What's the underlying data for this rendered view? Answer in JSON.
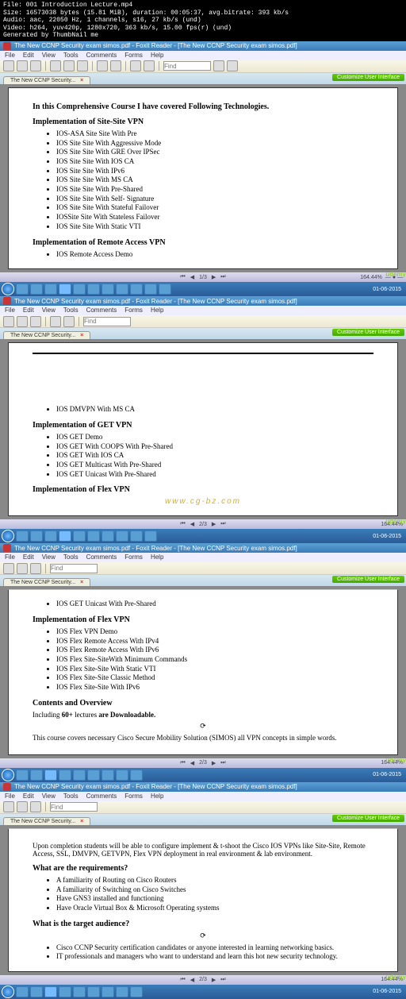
{
  "video_meta": [
    "File: 001 Introduction Lecture.mp4",
    "Size: 16573038 bytes (15.81 MiB), duration: 00:05:37, avg.bitrate: 393 kb/s",
    "Audio: aac, 22050 Hz, 1 channels, s16, 27 kb/s (und)",
    "Video: h264, yuv420p, 1280x720, 363 kb/s, 15.00 fps(r) (und)",
    "Generated by ThumbNail me"
  ],
  "window": {
    "title_full": "The New CCNP Security exam simos.pdf - Foxit Reader - [The New CCNP Security exam simos.pdf]",
    "title_short": "The New CCNP Security exam simos.pdf - Foxit Reader - [The New CCNP Security exam simos.pdf]",
    "tab_label": "The New CCNP Security...",
    "cui_label": "Customize User Interface"
  },
  "menu": [
    "File",
    "Edit",
    "View",
    "Tools",
    "Comments",
    "Forms",
    "Help"
  ],
  "toolbar": {
    "search_placeholder": "Find"
  },
  "status": {
    "page1": "1/3",
    "page2": "2/3",
    "page3": "2/3",
    "page4": "2/3",
    "zoom": "164.44%",
    "logo": "udemy",
    "time": "01-06-2015"
  },
  "seg1": {
    "h1": "In this Comprehensive Course I have covered Following Technologies.",
    "h2": "Implementation of Site-Site VPN",
    "items": [
      "IOS-ASA Site Site With Pre",
      "IOS Site Site With Aggressive Mode",
      "IOS Site Site With GRE Over IPSec",
      "IOS Site Site With IOS CA",
      "IOS Site Site With IPv6",
      "IOS Site Site With MS CA",
      "IOS Site Site With Pre-Shared",
      "IOS Site Site With Self- Signature",
      "IOS Site Site With Stateful Failover",
      "IOSSite Site With Stateless Failover",
      "IOS Site Site With Static VTI"
    ],
    "h3": "Implementation of Remote Access VPN",
    "items2": [
      "IOS Remote Access Demo"
    ]
  },
  "seg2": {
    "i1": [
      "IOS DMVPN With MS CA"
    ],
    "h1": "Implementation of GET VPN",
    "items": [
      "IOS GET Demo",
      "IOS GET With COOPS With Pre-Shared",
      "IOS GET With IOS CA",
      "IOS GET Multicast With Pre-Shared",
      "IOS GET Unicast With Pre-Shared"
    ],
    "h2": "Implementation of Flex VPN",
    "watermark": "www.cg-bz.com"
  },
  "seg3": {
    "i0": [
      "IOS GET Unicast With Pre-Shared"
    ],
    "h1": "Implementation of Flex VPN",
    "items": [
      "IOS Flex VPN Demo",
      "IOS Flex Remote Access With IPv4",
      "IOS Flex Remote Access With IPv6",
      "IOS Flex Site-SiteWith Minimum Commands",
      "IOS Flex Site-Site With Static VTI",
      "IOS Flex Site-Site Classic Method",
      "IOS Flex Site-Site With IPv6"
    ],
    "h2": "Contents and Overview",
    "p1a": "Including ",
    "p1b": "60+",
    "p1c": " lectures ",
    "p1d": "are Downloadable.",
    "p2": "This course covers necessary Cisco Secure Mobility Solution (SIMOS) all VPN concepts in simple words."
  },
  "seg4": {
    "p0": "Upon completion students will be able to configure implement & t-shoot the Cisco IOS VPNs like Site-Site, Remote Access, SSL, DMVPN, GETVPN, Flex VPN deployment in real environment & lab environment.",
    "h1": "What are the requirements?",
    "items1": [
      "A familiarity of Routing on Cisco Routers",
      "A familiarity of Switching on Cisco Switches",
      "Have GNS3 installed and functioning",
      "Have Oracle Virtual Box & Microsoft Operating systems"
    ],
    "h2": "What is the target audience?",
    "items2": [
      "Cisco CCNP Security certification candidates or anyone interested in learning networking basics.",
      "IT professionals and managers who want to understand and learn this hot new security technology."
    ]
  }
}
